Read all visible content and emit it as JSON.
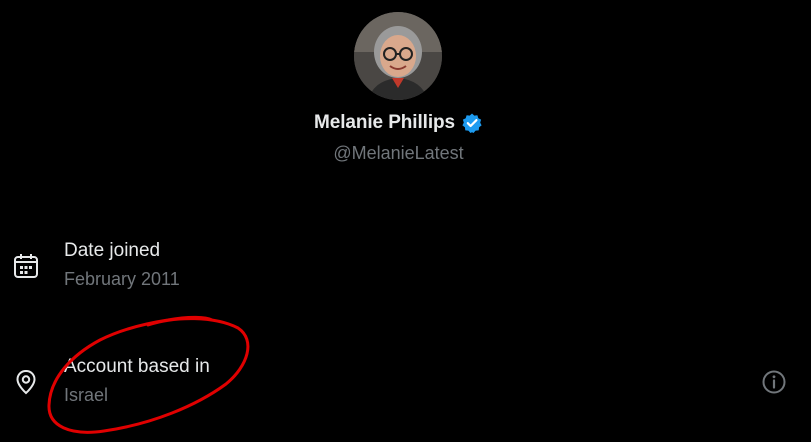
{
  "profile": {
    "display_name": "Melanie Phillips",
    "handle": "@MelanieLatest",
    "verified": true,
    "verified_badge_color": "#1d9bf0"
  },
  "about": {
    "date_joined": {
      "title": "Date joined",
      "value": "February 2011",
      "icon": "calendar-icon"
    },
    "account_based_in": {
      "title": "Account based in",
      "value": "Israel",
      "icon": "location-pin-icon",
      "info_icon": "info-icon"
    }
  },
  "annotation": {
    "type": "hand-drawn circle",
    "color": "#e00000"
  },
  "colors": {
    "background": "#000000",
    "primary_text": "#e7e9ea",
    "secondary_text": "#71767b"
  }
}
